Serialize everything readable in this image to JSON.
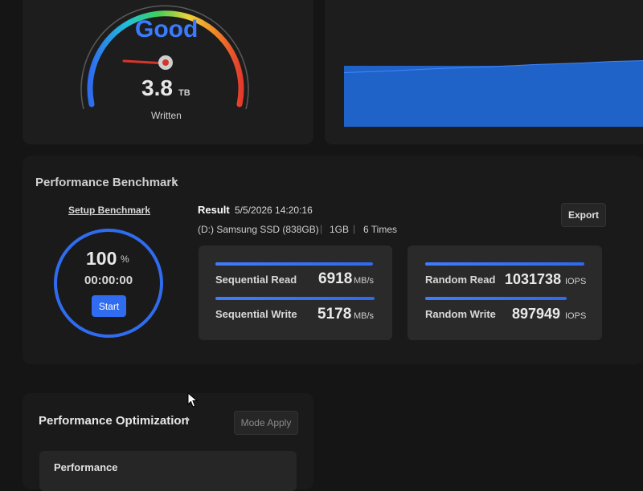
{
  "health": {
    "status": "Good",
    "written_value": "3.8",
    "written_unit": "TB",
    "written_label": "Written"
  },
  "benchmark": {
    "title": "Performance Benchmark",
    "setup_link": "Setup Benchmark",
    "progress_value": "100",
    "progress_unit": "%",
    "progress_fraction": 1.0,
    "elapsed": "00:00:00",
    "start_label": "Start",
    "result_label": "Result",
    "result_datetime": "5/5/2026 14:20:16",
    "drive": "(D:) Samsung SSD (838GB)",
    "size": "1GB",
    "times": "6 Times",
    "export_label": "Export",
    "sequential": [
      {
        "label": "Sequential Read",
        "value": "6918",
        "unit": "MB/s"
      },
      {
        "label": "Sequential Write",
        "value": "5178",
        "unit": "MB/s"
      }
    ],
    "random": [
      {
        "label": "Random Read",
        "value": "1031738",
        "unit": "IOPS"
      },
      {
        "label": "Random Write",
        "value": "897949",
        "unit": "IOPS"
      }
    ]
  },
  "optimization": {
    "title": "Performance Optimization",
    "mode_apply_label": "Mode Apply",
    "performance_label": "Performance"
  },
  "colors": {
    "accent_blue": "#2f6cf0",
    "status_blue": "#3a7bff",
    "gauge_red": "#e53b2c"
  }
}
